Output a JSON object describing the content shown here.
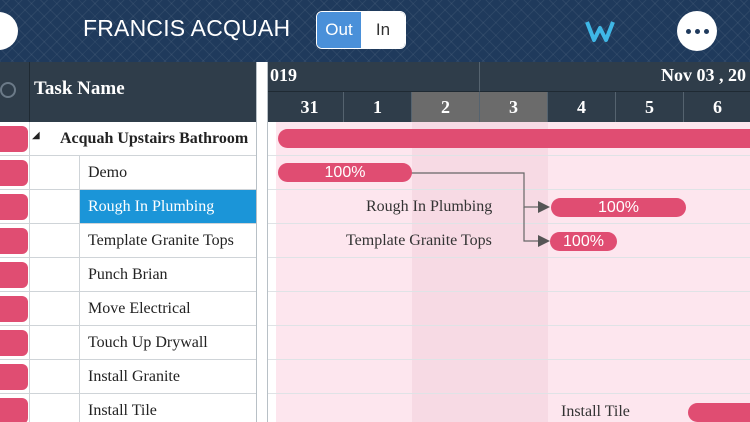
{
  "header": {
    "project_title": "FRANCIS ACQUAH",
    "toggle": {
      "out_label": "Out",
      "in_label": "In",
      "selected": "Out"
    },
    "logo_icon": "w-logo-icon",
    "more_icon": "more-horizontal-icon",
    "accent_color": "#4a90d9"
  },
  "grid": {
    "column_header": "Task Name",
    "rows": [
      {
        "name": "Acquah Upstairs Bathroom",
        "type": "group",
        "selected": false
      },
      {
        "name": "Demo",
        "type": "task",
        "selected": false
      },
      {
        "name": "Rough In Plumbing",
        "type": "task",
        "selected": true
      },
      {
        "name": "Template Granite Tops",
        "type": "task",
        "selected": false
      },
      {
        "name": "Punch Brian",
        "type": "task",
        "selected": false
      },
      {
        "name": "Move Electrical",
        "type": "task",
        "selected": false
      },
      {
        "name": "Touch Up Drywall",
        "type": "task",
        "selected": false
      },
      {
        "name": "Install Granite",
        "type": "task",
        "selected": false
      },
      {
        "name": "Install Tile",
        "type": "task",
        "selected": false
      }
    ]
  },
  "timeline": {
    "months": [
      "019",
      "Nov 03 , 20"
    ],
    "days": [
      {
        "label": "31",
        "weekend": false
      },
      {
        "label": "1",
        "weekend": false
      },
      {
        "label": "2",
        "weekend": true
      },
      {
        "label": "3",
        "weekend": true
      },
      {
        "label": "4",
        "weekend": false
      },
      {
        "label": "5",
        "weekend": false
      },
      {
        "label": "6",
        "weekend": false
      }
    ],
    "bars": {
      "demo_progress": "100%",
      "rough_in_progress": "100%",
      "template_progress": "100%"
    },
    "labels": {
      "rough_in": "Rough In Plumbing",
      "template": "Template Granite Tops",
      "install_tile": "Install Tile"
    },
    "bar_color": "#e04d72",
    "selected_color": "#1b95d8"
  }
}
